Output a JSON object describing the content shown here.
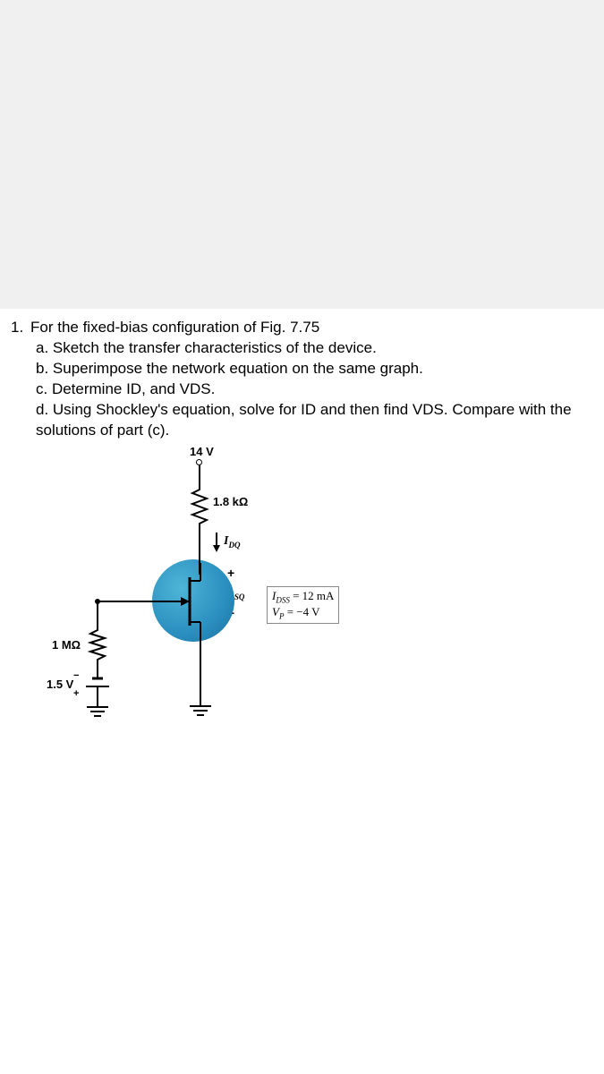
{
  "question": {
    "number": "1.",
    "stem": "For the fixed-bias configuration of Fig. 7.75",
    "parts": {
      "a": "a. Sketch the transfer characteristics of the device.",
      "b": "b. Superimpose the network equation on the same graph.",
      "c": "c. Determine ID, and VDS.",
      "d": "d. Using Shockley's equation, solve for ID and then find VDS. Compare with the solutions of part (c)."
    }
  },
  "circuit": {
    "vdd": "14 V",
    "rd": "1.8 kΩ",
    "idq": "I",
    "idq_sub": "DQ",
    "vdsq": "V",
    "vdsq_sub": "DSQ",
    "plus": "+",
    "minus": "−",
    "rg": "1 MΩ",
    "vgg": "1.5 V",
    "vgg_minus": "−",
    "vgg_plus": "+",
    "params": {
      "idss_lhs": "I",
      "idss_sub": "DSS",
      "idss_rhs": " = 12 mA",
      "vp_lhs": "V",
      "vp_sub": "P",
      "vp_rhs": " = −4 V"
    }
  }
}
